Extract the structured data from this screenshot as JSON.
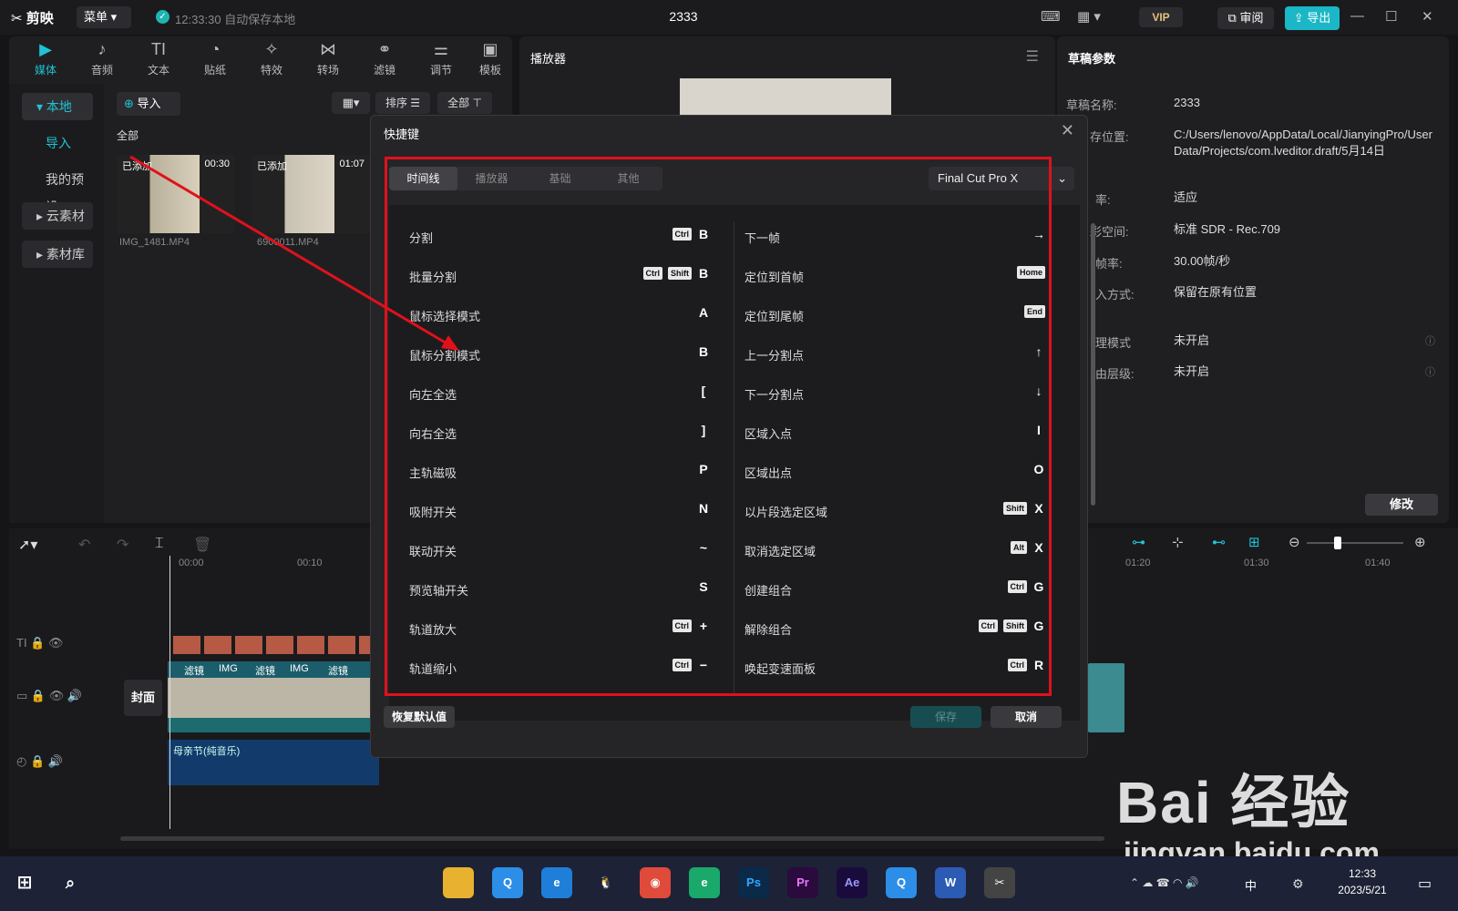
{
  "app": {
    "name": "剪映",
    "menu_label": "菜单",
    "autosave": "12:33:30 自动保存本地",
    "project_title": "2333",
    "vip_label": "VIP",
    "review_label": "审阅",
    "export_label": "导出"
  },
  "toolbar": {
    "items": [
      {
        "label": "媒体",
        "icon": "media-icon"
      },
      {
        "label": "音频",
        "icon": "audio-icon"
      },
      {
        "label": "文本",
        "icon": "text-icon"
      },
      {
        "label": "贴纸",
        "icon": "sticker-icon"
      },
      {
        "label": "特效",
        "icon": "effects-icon"
      },
      {
        "label": "转场",
        "icon": "transition-icon"
      },
      {
        "label": "滤镜",
        "icon": "filter-icon"
      },
      {
        "label": "调节",
        "icon": "adjust-icon"
      },
      {
        "label": "模板",
        "icon": "template-icon"
      }
    ]
  },
  "sidebar": {
    "items": [
      "本地",
      "导入",
      "我的预设",
      "云素材",
      "素材库"
    ]
  },
  "media": {
    "import_label": "导入",
    "sort_label": "排序",
    "filter_label": "全部",
    "section_label": "全部",
    "clips": [
      {
        "badge": "已添加",
        "duration": "00:30",
        "name": "IMG_1481.MP4"
      },
      {
        "badge": "已添加",
        "duration": "01:07",
        "name": "6900011.MP4"
      }
    ]
  },
  "player": {
    "title": "播放器"
  },
  "draft": {
    "title": "草稿参数",
    "props": [
      {
        "label": "草稿名称:",
        "value": "2333"
      },
      {
        "label": "存位置:",
        "value": "C:/Users/lenovo/AppData/Local/JianyingPro/User Data/Projects/com.lveditor.draft/5月14日"
      },
      {
        "label": "率:",
        "value": "适应"
      },
      {
        "label": "彩空间:",
        "value": "标准 SDR - Rec.709"
      },
      {
        "label": "帧率:",
        "value": "30.00帧/秒"
      },
      {
        "label": "入方式:",
        "value": "保留在原有位置"
      },
      {
        "label": "理模式",
        "value": "未开启"
      },
      {
        "label": "由层级:",
        "value": "未开启"
      }
    ],
    "edit_label": "修改"
  },
  "timeline": {
    "ticks": [
      "00:00",
      "00:10",
      "01:20",
      "01:30",
      "01:40"
    ],
    "cover_label": "封面",
    "audio_clip": "母亲节(纯音乐)",
    "video_clip_labels": [
      "滤镜",
      "IMG",
      "滤镜",
      "IMG",
      "滤镜"
    ]
  },
  "dialog": {
    "title": "快捷键",
    "tabs": [
      "时间线",
      "播放器",
      "基础",
      "其他"
    ],
    "preset": "Final Cut Pro X",
    "left": [
      {
        "label": "分割",
        "mods": [
          "Ctrl"
        ],
        "key": "B"
      },
      {
        "label": "批量分割",
        "mods": [
          "Ctrl",
          "Shift"
        ],
        "key": "B"
      },
      {
        "label": "鼠标选择模式",
        "mods": [],
        "key": "A"
      },
      {
        "label": "鼠标分割模式",
        "mods": [],
        "key": "B"
      },
      {
        "label": "向左全选",
        "mods": [],
        "key": "["
      },
      {
        "label": "向右全选",
        "mods": [],
        "key": "]"
      },
      {
        "label": "主轨磁吸",
        "mods": [],
        "key": "P"
      },
      {
        "label": "吸附开关",
        "mods": [],
        "key": "N"
      },
      {
        "label": "联动开关",
        "mods": [],
        "key": "~"
      },
      {
        "label": "预览轴开关",
        "mods": [],
        "key": "S"
      },
      {
        "label": "轨道放大",
        "mods": [
          "Ctrl"
        ],
        "key": "+"
      },
      {
        "label": "轨道缩小",
        "mods": [
          "Ctrl"
        ],
        "key": "−"
      }
    ],
    "right": [
      {
        "label": "下一帧",
        "mods": [],
        "key": "→"
      },
      {
        "label": "定位到首帧",
        "mods": [
          "Home"
        ],
        "key": ""
      },
      {
        "label": "定位到尾帧",
        "mods": [
          "End"
        ],
        "key": ""
      },
      {
        "label": "上一分割点",
        "mods": [],
        "key": "↑"
      },
      {
        "label": "下一分割点",
        "mods": [],
        "key": "↓"
      },
      {
        "label": "区域入点",
        "mods": [],
        "key": "I"
      },
      {
        "label": "区域出点",
        "mods": [],
        "key": "O"
      },
      {
        "label": "以片段选定区域",
        "mods": [
          "Shift"
        ],
        "key": "X"
      },
      {
        "label": "取消选定区域",
        "mods": [
          "Alt"
        ],
        "key": "X"
      },
      {
        "label": "创建组合",
        "mods": [
          "Ctrl"
        ],
        "key": "G"
      },
      {
        "label": "解除组合",
        "mods": [
          "Ctrl",
          "Shift"
        ],
        "key": "G"
      },
      {
        "label": "唤起变速面板",
        "mods": [
          "Ctrl"
        ],
        "key": "R"
      }
    ],
    "reset_label": "恢复默认值",
    "save_label": "保存",
    "cancel_label": "取消"
  },
  "taskbar": {
    "time": "12:33",
    "date": "2023/5/21",
    "ime": "中"
  },
  "watermark": {
    "line1": "Bai 经验",
    "line2": "jingyan.baidu.com"
  },
  "colors": {
    "accent": "#1fc3d4",
    "annotation": "#e0111b"
  }
}
